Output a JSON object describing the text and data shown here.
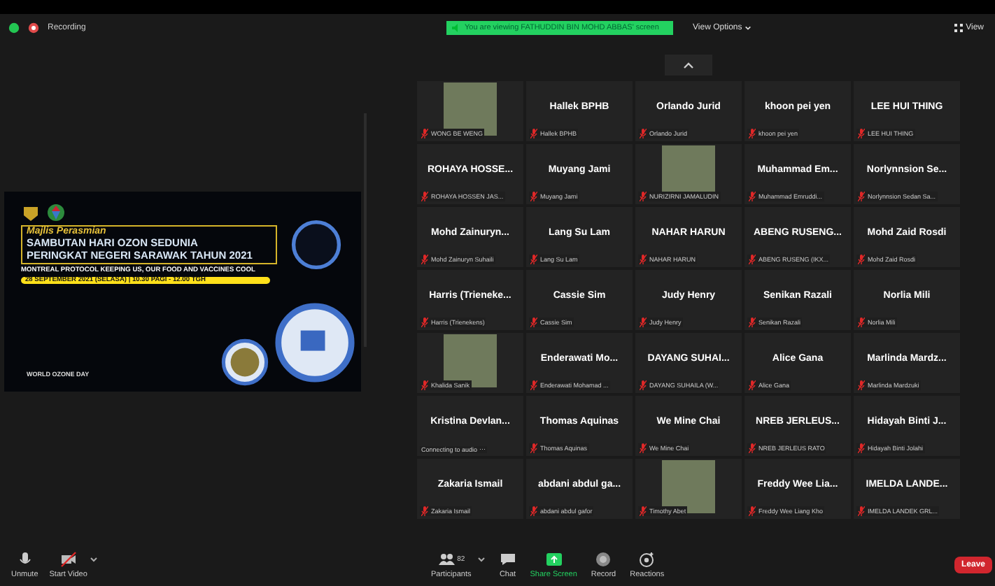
{
  "top_bar": {
    "recording": "Recording",
    "banner": "You are viewing FATHUDDIN BIN MOHD ABBAS' screen",
    "view_options": "View Options",
    "view": "View"
  },
  "shared_screen": {
    "lines": [
      "Majlis Perasmian",
      "SAMBUTAN HARI OZON SEDUNIA",
      "PERINGKAT NEGERI SARAWAK TAHUN 2021",
      "MONTREAL PROTOCOL KEEPING US, OUR FOOD AND VACCINES COOL",
      "28 SEPTEMBER 2021 (SELASA) | 10.30 PAGI - 12.00 TGH",
      "WORLD OZONE DAY"
    ]
  },
  "participants": [
    {
      "kind": "photo",
      "label": "WONG BE WENG",
      "muted": true
    },
    {
      "kind": "name",
      "name": "Hallek BPHB",
      "label": "Hallek BPHB",
      "muted": true
    },
    {
      "kind": "name",
      "name": "Orlando Jurid",
      "label": "Orlando Jurid",
      "muted": true
    },
    {
      "kind": "name",
      "name": "khoon pei yen",
      "label": "khoon pei yen",
      "muted": true
    },
    {
      "kind": "name",
      "name": "LEE HUI THING",
      "label": "LEE HUI THING",
      "muted": true
    },
    {
      "kind": "name",
      "name": "ROHAYA HOSSE...",
      "label": "ROHAYA HOSSEN JAS...",
      "muted": true
    },
    {
      "kind": "name",
      "name": "Muyang Jami",
      "label": "Muyang Jami",
      "muted": true
    },
    {
      "kind": "photo",
      "label": "NURIZIRNI JAMALUDIN",
      "muted": true
    },
    {
      "kind": "name",
      "name": "Muhammad Em...",
      "label": "Muhammad Emruddi...",
      "muted": true
    },
    {
      "kind": "name",
      "name": "Norlynnsion Se...",
      "label": "Norlynnsion Sedan Sa...",
      "muted": true
    },
    {
      "kind": "name",
      "name": "Mohd Zainuryn...",
      "label": "Mohd Zainuryn Suhaili",
      "muted": true
    },
    {
      "kind": "name",
      "name": "Lang Su Lam",
      "label": "Lang Su Lam",
      "muted": true
    },
    {
      "kind": "name",
      "name": "NAHAR HARUN",
      "label": "NAHAR HARUN",
      "muted": true
    },
    {
      "kind": "name",
      "name": "ABENG RUSENG...",
      "label": "ABENG RUSENG (IKX...",
      "muted": true
    },
    {
      "kind": "name",
      "name": "Mohd Zaid Rosdi",
      "label": "Mohd Zaid Rosdi",
      "muted": true
    },
    {
      "kind": "name",
      "name": "Harris (Trieneke...",
      "label": "Harris (Trienekens)",
      "muted": true
    },
    {
      "kind": "name",
      "name": "Cassie Sim",
      "label": "Cassie Sim",
      "muted": true
    },
    {
      "kind": "name",
      "name": "Judy Henry",
      "label": "Judy Henry",
      "muted": true
    },
    {
      "kind": "name",
      "name": "Senikan Razali",
      "label": "Senikan Razali",
      "muted": true
    },
    {
      "kind": "name",
      "name": "Norlia Mili",
      "label": "Norlia Mili",
      "muted": true
    },
    {
      "kind": "photo",
      "label": "Khalida Sanik",
      "muted": true
    },
    {
      "kind": "name",
      "name": "Enderawati Mo...",
      "label": "Enderawati Mohamad ...",
      "muted": true
    },
    {
      "kind": "name",
      "name": "DAYANG SUHAI...",
      "label": "DAYANG SUHAILA (W...",
      "muted": true
    },
    {
      "kind": "name",
      "name": "Alice Gana",
      "label": "Alice Gana",
      "muted": true
    },
    {
      "kind": "name",
      "name": "Marlinda Mardz...",
      "label": "Marlinda Mardzuki",
      "muted": true
    },
    {
      "kind": "name",
      "name": "Kristina Devlan...",
      "label": "Connecting to audio ⋯",
      "muted": false
    },
    {
      "kind": "name",
      "name": "Thomas Aquinas",
      "label": "Thomas Aquinas",
      "muted": true
    },
    {
      "kind": "name",
      "name": "We Mine Chai",
      "label": "We Mine Chai",
      "muted": true
    },
    {
      "kind": "name",
      "name": "NREB JERLEUS...",
      "label": "NREB JERLEUS RATO",
      "muted": true
    },
    {
      "kind": "name",
      "name": "Hidayah Binti J...",
      "label": "Hidayah Binti Jolahi",
      "muted": true
    },
    {
      "kind": "name",
      "name": "Zakaria Ismail",
      "label": "Zakaria Ismail",
      "muted": true
    },
    {
      "kind": "name",
      "name": "abdani abdul ga...",
      "label": "abdani abdul gafor",
      "muted": true
    },
    {
      "kind": "photo",
      "label": "Timothy Abet",
      "muted": true
    },
    {
      "kind": "name",
      "name": "Freddy Wee Lia...",
      "label": "Freddy Wee Liang Kho",
      "muted": true
    },
    {
      "kind": "name",
      "name": "IMELDA LANDE...",
      "label": "IMELDA LANDEK GRL...",
      "muted": true
    }
  ],
  "toolbar": {
    "unmute": "Unmute",
    "start_video": "Start Video",
    "participants": "Participants",
    "participant_count": "82",
    "chat": "Chat",
    "share_screen": "Share Screen",
    "record": "Record",
    "reactions": "Reactions",
    "leave": "Leave"
  }
}
